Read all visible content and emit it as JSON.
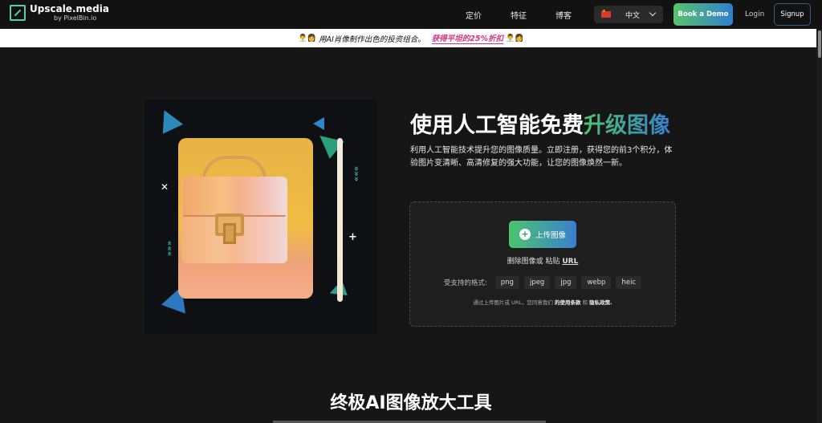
{
  "nav": {
    "logo_title": "Upscale.media",
    "logo_sub": "by PixelBin.io",
    "links": [
      "定价",
      "特征",
      "博客"
    ],
    "language": "中文",
    "demo_label": "Book a Demo",
    "login_label": "Login",
    "signup_label": "Signup"
  },
  "promo": {
    "text": "用AI肖像制作出色的投资组合。",
    "link": "获得平坦的25%折扣"
  },
  "hero": {
    "title_plain": "使用人工智能免费",
    "title_accent": "升级图像",
    "description": "利用人工智能技术提升您的图像质量。立即注册，获得您的前3个积分，体验图片变清晰、高清修复的强大功能，让您的图像焕然一新。"
  },
  "upload": {
    "button_label": "上传图像",
    "paste_prefix": "删除图像或 粘贴",
    "paste_url": "URL",
    "formats_label": "受支持的格式:",
    "formats": [
      "png",
      "jpeg",
      "jpg",
      "webp",
      "heic"
    ],
    "terms_prefix": "通过上传图片或 URL，您同意我们",
    "terms_link": "的使用条款",
    "terms_and": "和",
    "privacy_link": "隐私政策."
  },
  "section": {
    "title": "终极AI图像放大工具"
  },
  "colors": {
    "accent_green": "#4cc46f",
    "accent_blue": "#3b7fd0",
    "promo_link": "#d6327a"
  }
}
